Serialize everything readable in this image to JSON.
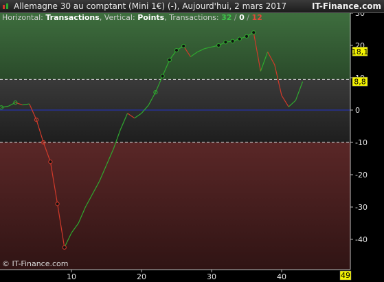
{
  "window": {
    "title": "Allemagne 30 au comptant (Mini 1€) (-), Aujourd'hui, 2 mars 2017",
    "brand": "IT-Finance.com",
    "copyright": "© IT-Finance.com"
  },
  "subtitle": {
    "horizontal_label": "Horizontal:",
    "horizontal_value": "Transactions",
    "vertical_label": ", Vertical:",
    "vertical_value": "Points",
    "transactions_label": ", Transactions:",
    "count_total": "32",
    "sep1": " / ",
    "count_neutral": "0",
    "sep2": " / ",
    "count_losing": "12"
  },
  "colors": {
    "gain": "#2faa2f",
    "loss": "#d23a2a",
    "zero_line": "#2233cc",
    "upper_zone": "#2f5a2f",
    "lower_zone": "#4a2222",
    "marker_bg": "#f5f500"
  },
  "chart_data": {
    "type": "line",
    "xlim": [
      0,
      49
    ],
    "ylim": [
      -48,
      30
    ],
    "x_ticks": [
      10,
      20,
      30,
      40
    ],
    "y_ticks": [
      30,
      20,
      10,
      0,
      -10,
      -20,
      -30,
      -40
    ],
    "x_tick_labels": [
      "10",
      "20",
      "30",
      "40"
    ],
    "y_tick_labels": [
      "30",
      "20",
      "10",
      "0",
      "-10",
      "-20",
      "-30",
      "-40"
    ],
    "upper_threshold": 9.5,
    "lower_threshold": -10,
    "markers": {
      "last_value": "18,1",
      "upper_value": "8,8",
      "x_max": "49"
    },
    "series": [
      {
        "values": [
          {
            "x": 0,
            "y": 0.8
          },
          {
            "x": 1,
            "y": 1.2
          },
          {
            "x": 2,
            "y": 2.3
          },
          {
            "x": 3,
            "y": 1.6
          },
          {
            "x": 4,
            "y": 1.9
          },
          {
            "x": 5,
            "y": -3.0
          },
          {
            "x": 6,
            "y": -10.0
          },
          {
            "x": 7,
            "y": -16.0
          },
          {
            "x": 8,
            "y": -29.0
          },
          {
            "x": 9,
            "y": -42.5
          },
          {
            "x": 10,
            "y": -38.0
          },
          {
            "x": 11,
            "y": -35.0
          },
          {
            "x": 12,
            "y": -30.0
          },
          {
            "x": 13,
            "y": -26.0
          },
          {
            "x": 14,
            "y": -22.0
          },
          {
            "x": 15,
            "y": -17.0
          },
          {
            "x": 16,
            "y": -12.0
          },
          {
            "x": 17,
            "y": -6.0
          },
          {
            "x": 18,
            "y": -1.0
          },
          {
            "x": 19,
            "y": -2.5
          },
          {
            "x": 20,
            "y": -1.0
          },
          {
            "x": 21,
            "y": 1.5
          },
          {
            "x": 22,
            "y": 5.5
          },
          {
            "x": 23,
            "y": 10.5
          },
          {
            "x": 24,
            "y": 15.5
          },
          {
            "x": 25,
            "y": 18.5
          },
          {
            "x": 26,
            "y": 19.8
          },
          {
            "x": 27,
            "y": 16.5
          },
          {
            "x": 28,
            "y": 18.0
          },
          {
            "x": 29,
            "y": 19.0
          },
          {
            "x": 30,
            "y": 19.5
          },
          {
            "x": 31,
            "y": 20.0
          },
          {
            "x": 32,
            "y": 21.0
          },
          {
            "x": 33,
            "y": 21.3
          },
          {
            "x": 34,
            "y": 22.0
          },
          {
            "x": 35,
            "y": 22.8
          },
          {
            "x": 36,
            "y": 24.0
          },
          {
            "x": 37,
            "y": 12.0
          },
          {
            "x": 38,
            "y": 18.0
          },
          {
            "x": 39,
            "y": 14.0
          },
          {
            "x": 40,
            "y": 4.5
          },
          {
            "x": 41,
            "y": 1.0
          },
          {
            "x": 42,
            "y": 3.0
          },
          {
            "x": 43,
            "y": 8.8
          }
        ]
      }
    ],
    "dots": [
      {
        "x": 0,
        "y": 0.8,
        "style": "open"
      },
      {
        "x": 2,
        "y": 2.3,
        "style": "open"
      },
      {
        "x": 5,
        "y": -3.0,
        "style": "open"
      },
      {
        "x": 6,
        "y": -10.0,
        "style": "open"
      },
      {
        "x": 7,
        "y": -16.0,
        "style": "filled"
      },
      {
        "x": 8,
        "y": -29.0,
        "style": "filled"
      },
      {
        "x": 9,
        "y": -42.5,
        "style": "filled"
      },
      {
        "x": 22,
        "y": 5.5,
        "style": "open"
      },
      {
        "x": 23,
        "y": 10.5,
        "style": "filled"
      },
      {
        "x": 24,
        "y": 15.5,
        "style": "filled"
      },
      {
        "x": 25,
        "y": 18.5,
        "style": "filled"
      },
      {
        "x": 26,
        "y": 19.8,
        "style": "filled"
      },
      {
        "x": 31,
        "y": 20.0,
        "style": "filled"
      },
      {
        "x": 32,
        "y": 21.0,
        "style": "filled"
      },
      {
        "x": 33,
        "y": 21.3,
        "style": "filled"
      },
      {
        "x": 34,
        "y": 22.0,
        "style": "filled"
      },
      {
        "x": 35,
        "y": 22.8,
        "style": "filled"
      },
      {
        "x": 36,
        "y": 24.0,
        "style": "filled"
      }
    ]
  }
}
